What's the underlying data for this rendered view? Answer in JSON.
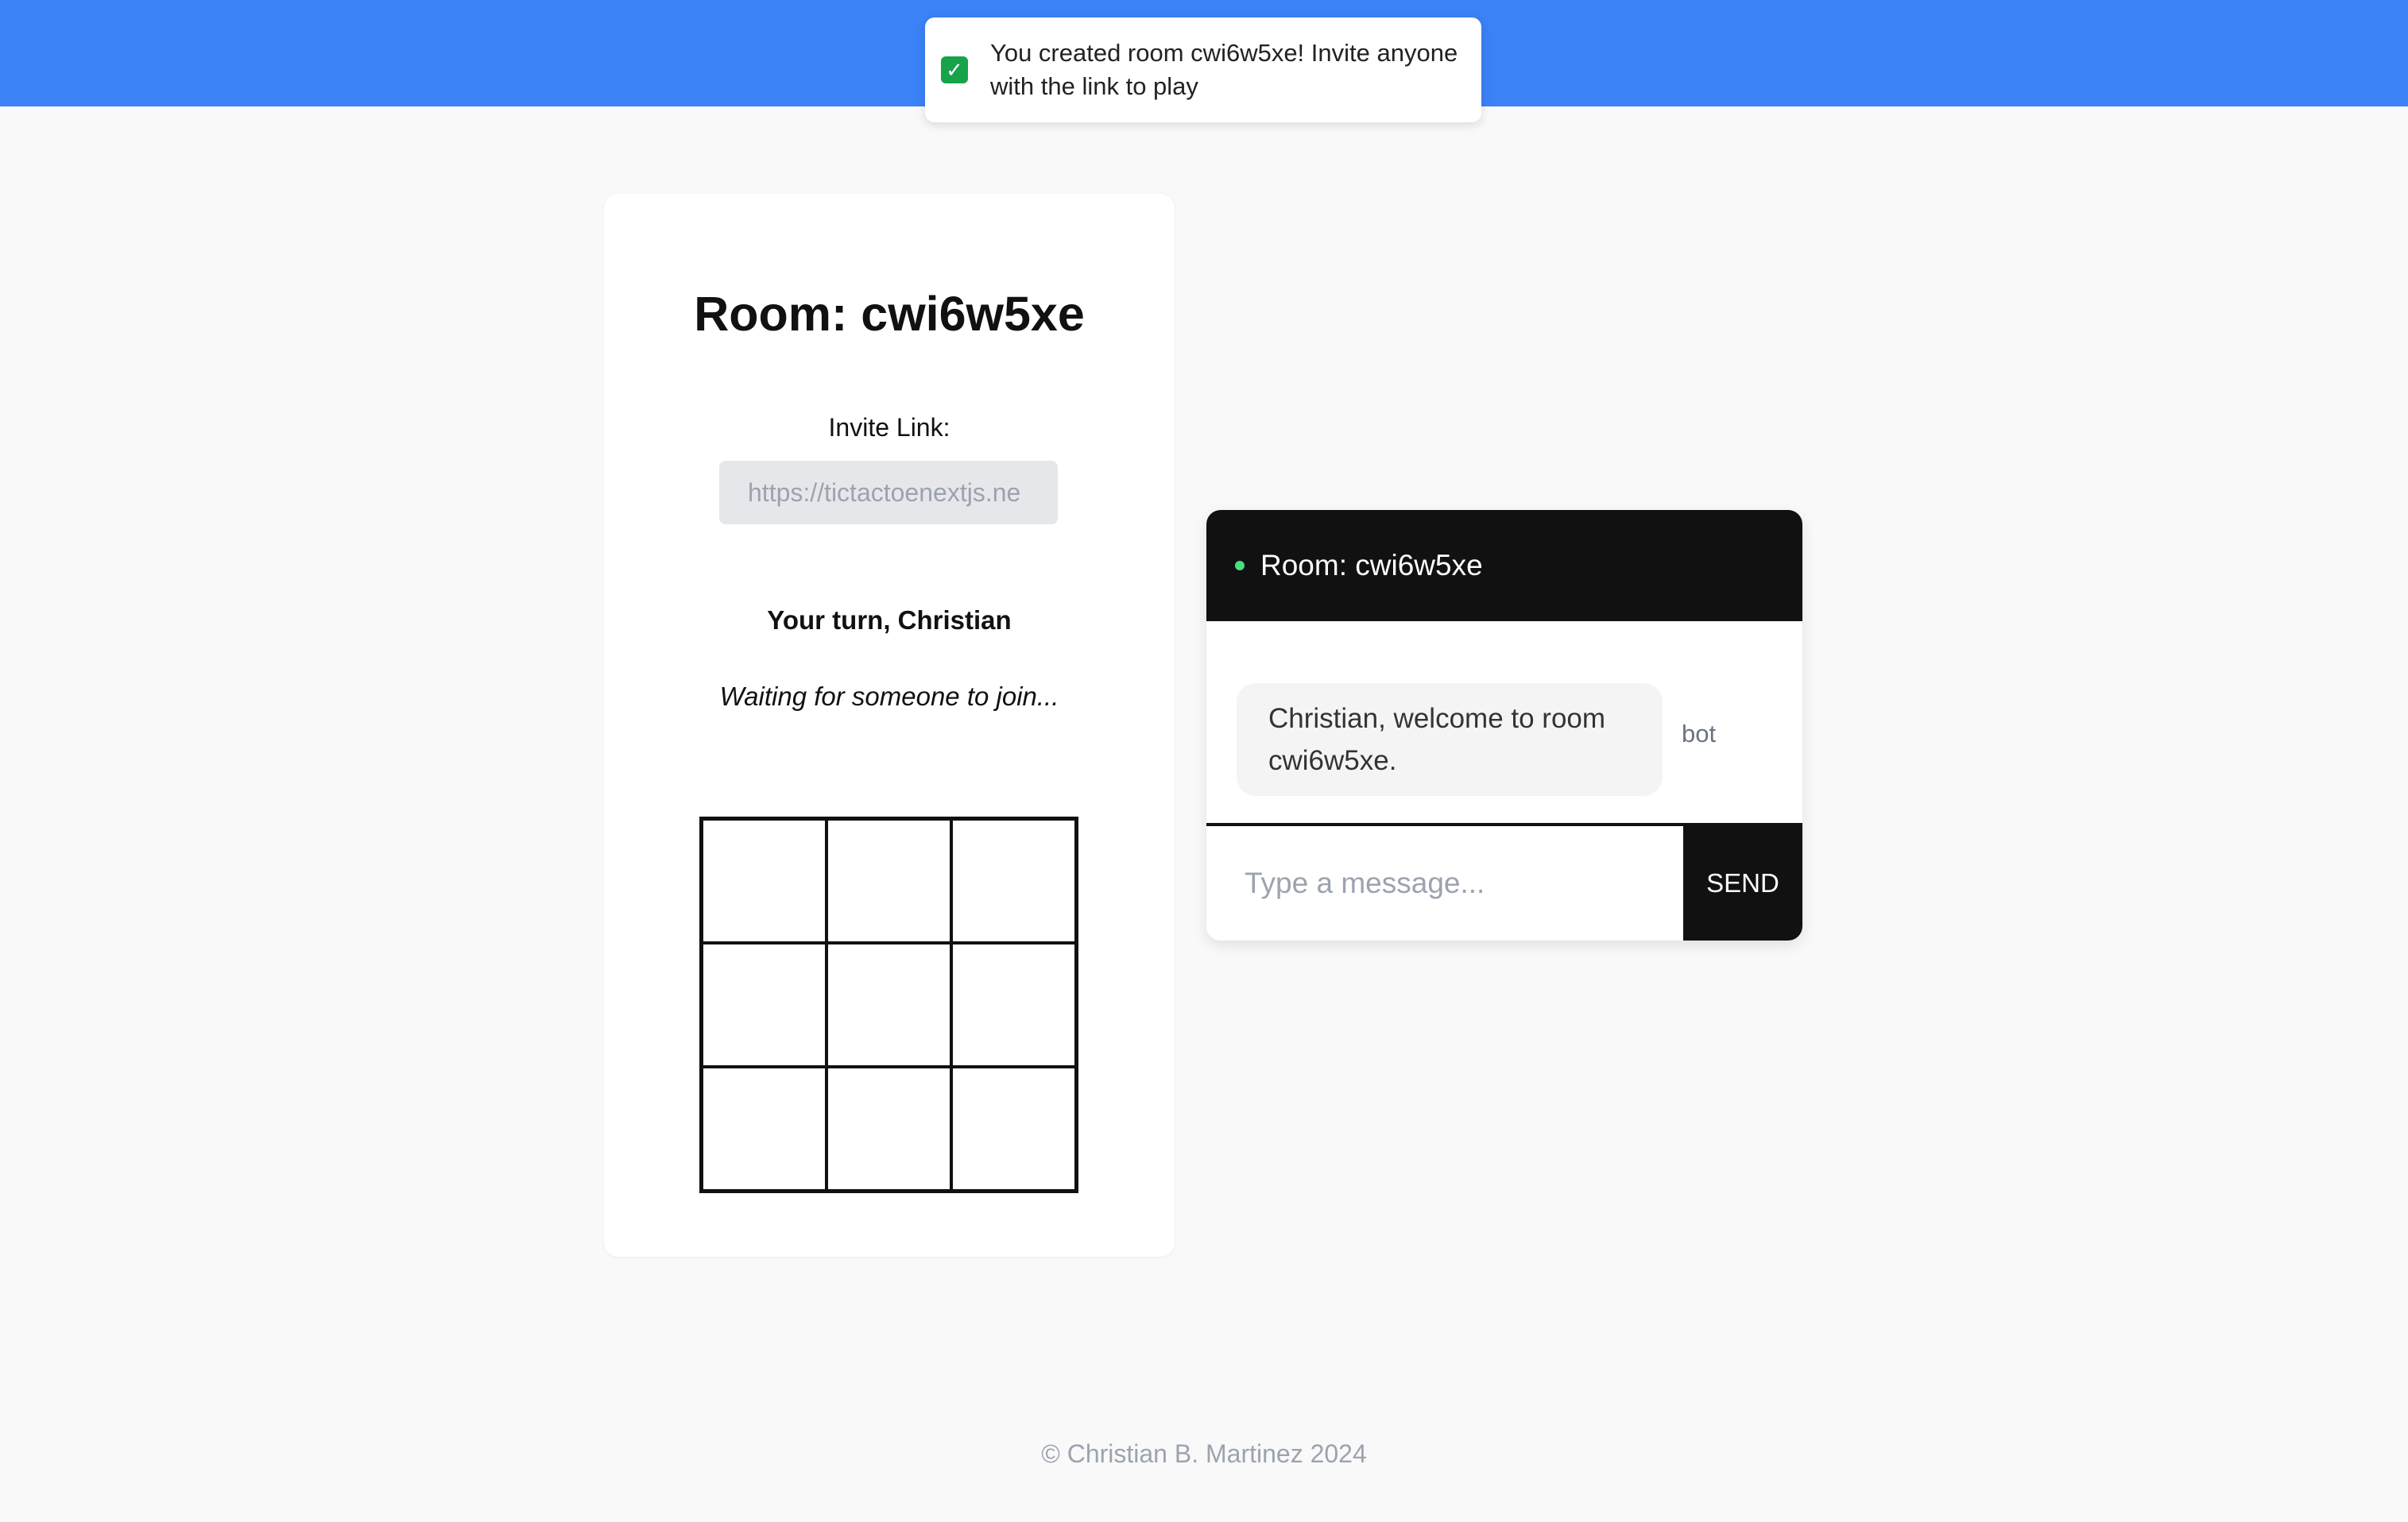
{
  "toast": {
    "icon": "check-icon",
    "message": "You created room cwi6w5xe! Invite anyone with the link to play"
  },
  "game": {
    "title": "Room: cwi6w5xe",
    "invite_label": "Invite Link:",
    "invite_value": "https://tictactoenextjs.ne",
    "turn_text": "Your turn, Christian",
    "waiting_text": "Waiting for someone to join...",
    "board": [
      "",
      "",
      "",
      "",
      "",
      "",
      "",
      "",
      ""
    ]
  },
  "chat": {
    "title": "Room: cwi6w5xe",
    "messages": [
      {
        "text": "Christian, welcome to room cwi6w5xe.",
        "sender": "bot"
      }
    ],
    "input_placeholder": "Type a message...",
    "send_label": "SEND"
  },
  "footer": {
    "text": "© Christian B. Martinez 2024"
  },
  "colors": {
    "topbar": "#3b82f6",
    "status_dot": "#4ade80",
    "chat_header": "#111111"
  }
}
